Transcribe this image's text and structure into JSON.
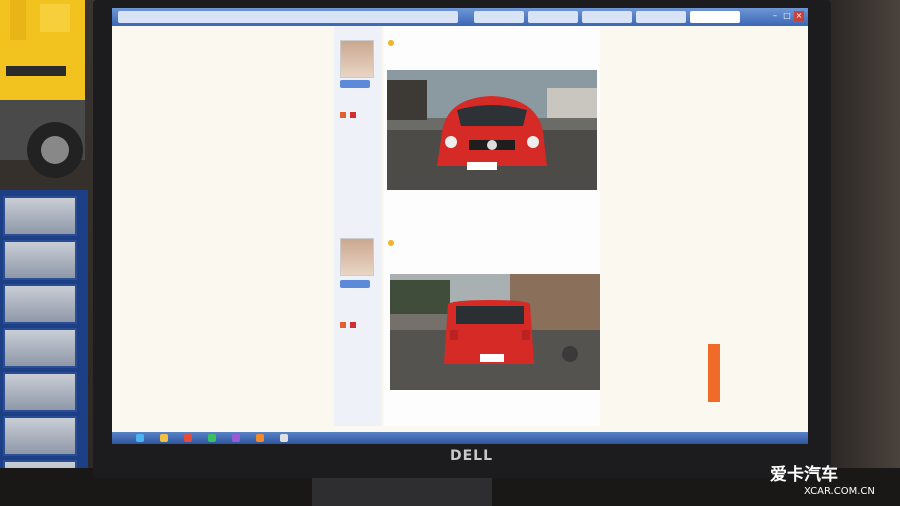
{
  "browser": {
    "tabs": [
      "",
      "",
      "",
      "",
      "",
      ""
    ]
  },
  "forum": {
    "post1": {
      "caption": "",
      "quote": "↵"
    },
    "post2": {
      "caption": "",
      "quote": "↵"
    },
    "user1": {
      "name": "",
      "level": ""
    },
    "user2": {
      "name": "",
      "level": ""
    }
  },
  "photos": [
    {
      "subject": "red VW Polo front view on street"
    },
    {
      "subject": "red VW Polo rear view on street"
    }
  ],
  "monitor": {
    "brand": "DELL"
  },
  "watermark": {
    "main": "爱卡汽车",
    "sub": "XCAR.COM.CN"
  },
  "colors": {
    "screen_bg": "#fbf8ef",
    "taskbar": "#3b66b4",
    "car_red": "#d62a26",
    "float_tool": "#f06a2a"
  }
}
